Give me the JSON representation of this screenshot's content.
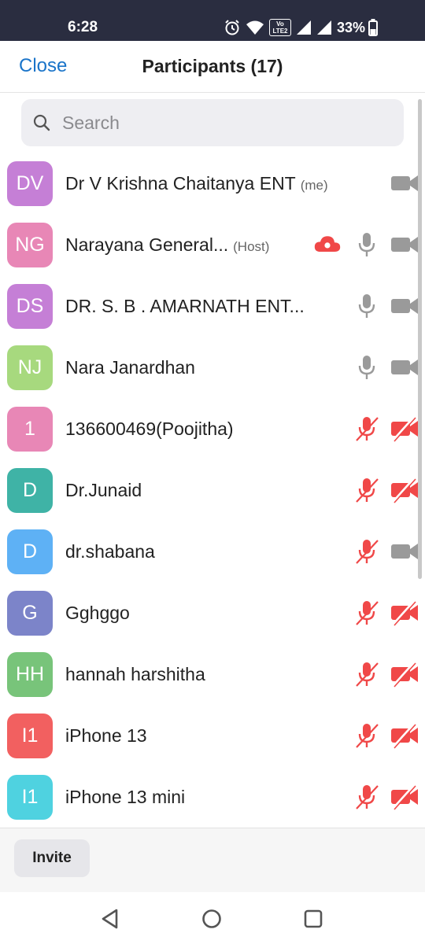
{
  "status_bar": {
    "time": "6:28",
    "lte_label_top": "Vo",
    "lte_label_bottom": "LTE2",
    "battery_text": "33%"
  },
  "header": {
    "close_label": "Close",
    "title": "Participants (17)"
  },
  "search": {
    "placeholder": "Search"
  },
  "participants": [
    {
      "initials": "DV",
      "name": "Dr V  Krishna  Chaitanya ENT",
      "tag": "(me)",
      "avatar_color": "#c57fd6",
      "mic": "none",
      "cam": "off-gray",
      "recording": false
    },
    {
      "initials": "NG",
      "name": "Narayana General...",
      "tag": "(Host)",
      "avatar_color": "#e887b6",
      "mic": "on",
      "cam": "off-gray",
      "recording": true
    },
    {
      "initials": "DS",
      "name": "DR. S. B . AMARNATH ENT...",
      "tag": "",
      "avatar_color": "#c57fd6",
      "mic": "on",
      "cam": "off-gray",
      "recording": false
    },
    {
      "initials": "NJ",
      "name": "Nara Janardhan",
      "tag": "",
      "avatar_color": "#a7d97e",
      "mic": "on",
      "cam": "off-gray",
      "recording": false
    },
    {
      "initials": "1",
      "name": "136600469(Poojitha)",
      "tag": "",
      "avatar_color": "#e887b6",
      "mic": "muted",
      "cam": "muted",
      "recording": false
    },
    {
      "initials": "D",
      "name": "Dr.Junaid",
      "tag": "",
      "avatar_color": "#3fb3a6",
      "mic": "muted",
      "cam": "muted",
      "recording": false
    },
    {
      "initials": "D",
      "name": "dr.shabana",
      "tag": "",
      "avatar_color": "#5eb1f5",
      "mic": "muted",
      "cam": "off-gray",
      "recording": false
    },
    {
      "initials": "G",
      "name": "Gghggo",
      "tag": "",
      "avatar_color": "#7c84c9",
      "mic": "muted",
      "cam": "muted",
      "recording": false
    },
    {
      "initials": "HH",
      "name": "hannah harshitha",
      "tag": "",
      "avatar_color": "#78c47a",
      "mic": "muted",
      "cam": "muted",
      "recording": false
    },
    {
      "initials": "I1",
      "name": "iPhone 13",
      "tag": "",
      "avatar_color": "#f26060",
      "mic": "muted",
      "cam": "muted",
      "recording": false
    },
    {
      "initials": "I1",
      "name": "iPhone 13 mini",
      "tag": "",
      "avatar_color": "#4fd2e0",
      "mic": "muted",
      "cam": "muted",
      "recording": false
    }
  ],
  "icons": {
    "status": [
      "alarm-icon",
      "wifi-icon",
      "lte-icon",
      "signal-icon",
      "signal-icon",
      "battery-icon"
    ],
    "search": "search-icon",
    "row": [
      "cloud-recording-icon",
      "microphone-icon",
      "microphone-muted-icon",
      "video-camera-icon",
      "video-camera-muted-icon"
    ],
    "nav": [
      "back-icon",
      "home-icon",
      "recents-icon"
    ]
  },
  "colors": {
    "accent": "#1a74c9",
    "muted_red": "#f04848",
    "icon_gray": "#9a9a9a",
    "status_bar": "#2a2d40"
  },
  "footer": {
    "invite_label": "Invite"
  }
}
